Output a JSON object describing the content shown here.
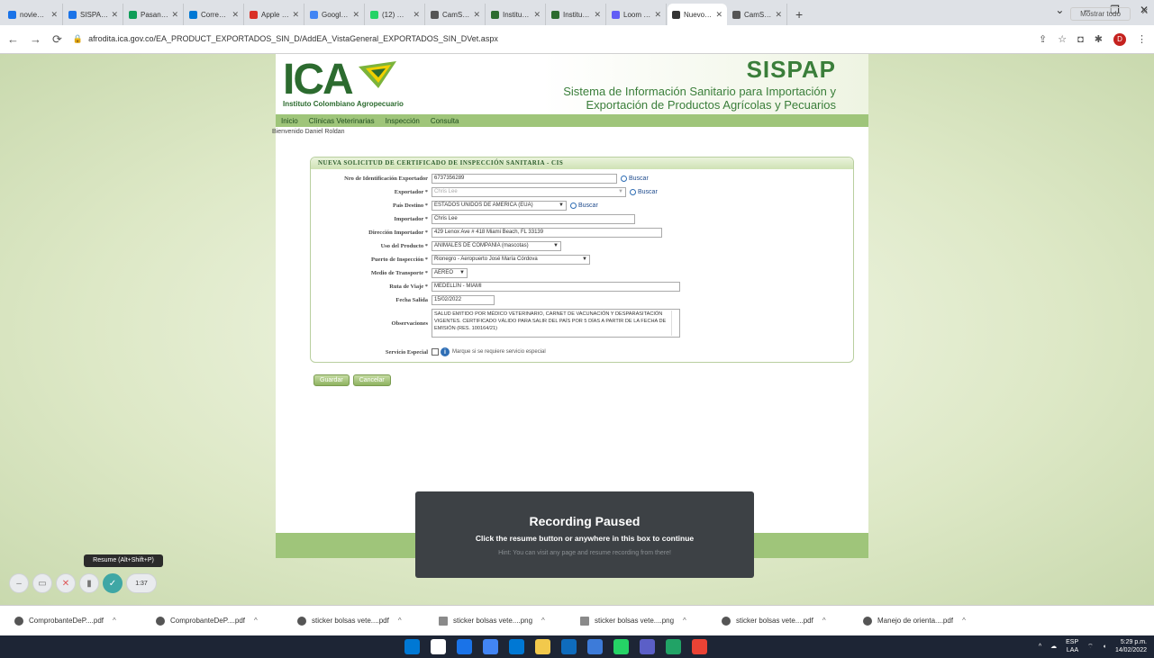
{
  "browser": {
    "tabs": [
      {
        "title": "noviembre",
        "color": "#1a73e8"
      },
      {
        "title": "SISPAP - Di",
        "color": "#1a73e8"
      },
      {
        "title": "Pasantes in",
        "color": "#0f9d58"
      },
      {
        "title": "Correo: Dia",
        "color": "#0078d4"
      },
      {
        "title": "Apple Mus",
        "color": "#d93025"
      },
      {
        "title": "Google Cal",
        "color": "#4285f4"
      },
      {
        "title": "(12) Whats",
        "color": "#25d366"
      },
      {
        "title": "CamScann",
        "color": "#555555"
      },
      {
        "title": "Instituto Co",
        "color": "#2c6b2f"
      },
      {
        "title": "Instituto Co",
        "color": "#2c6b2f"
      },
      {
        "title": "Loom | Fre",
        "color": "#625df5"
      },
      {
        "title": "Nuevo CIS",
        "color": "#333333",
        "active": true
      },
      {
        "title": "CamScann",
        "color": "#555555"
      }
    ],
    "url": "afrodita.ica.gov.co/EA_PRODUCT_EXPORTADOS_SIN_D/AddEA_VistaGeneral_EXPORTADOS_SIN_DVet.aspx"
  },
  "header": {
    "logo": "ICA",
    "logo_subtitle": "Instituto Colombiano Agropecuario",
    "app_name": "SISPAP",
    "app_description": "Sistema de Información Sanitario para Importación y Exportación de Productos Agrícolas y Pecuarios"
  },
  "menu": {
    "items": [
      "Inicio",
      "Clínicas Veterinarias",
      "Inspección",
      "Consulta"
    ],
    "welcome": "Bienvenido Daniel Roldan"
  },
  "form": {
    "title": "NUEVA SOLICITUD DE CERTIFICADO DE INSPECCIÓN SANITARIA - CIS",
    "buscar_label": "Buscar",
    "fields": {
      "nro_id": {
        "label": "Nro de Identificación Exportador",
        "value": "6737356289"
      },
      "exportador": {
        "label": "Exportador *",
        "value": "Chris Lee"
      },
      "pais_destino": {
        "label": "País Destino *",
        "value": "ESTADOS UNIDOS DE AMERICA (EUA)"
      },
      "importador": {
        "label": "Importador *",
        "value": "Chris Lee"
      },
      "direccion": {
        "label": "Dirección Importador *",
        "value": "429 Lenox Ave # 418 Miami Beach, FL 33139"
      },
      "uso": {
        "label": "Uso del Producto *",
        "value": "ANIMALES DE COMPAÑÍA (mascotas)"
      },
      "puerto": {
        "label": "Puerto de Inspección *",
        "value": "Rionegro - Aeropuerto José María Córdova"
      },
      "medio": {
        "label": "Medio de Transporte *",
        "value": "AÉREO"
      },
      "ruta": {
        "label": "Ruta de Viaje *",
        "value": "MEDELLÍN - MIAMI"
      },
      "fecha": {
        "label": "Fecha Salida",
        "value": "15/02/2022"
      },
      "observaciones": {
        "label": "Observaciones",
        "value": "SALUD EMITIDO POR MÉDICO VETERINARIO, CARNET DE VACUNACIÓN Y DESPARASITACIÓN VIGENTES. CERTIFICADO VÁLIDO PARA SALIR DEL PAÍS POR 5 DÍAS A PARTIR DE LA FECHA DE EMISIÓN (RES. 100164/21)"
      },
      "servicio": {
        "label": "Servicio Especial",
        "hint": "Marque si se requiere servicio especial"
      }
    },
    "buttons": {
      "save": "Guardar",
      "cancel": "Cancelar"
    }
  },
  "recording": {
    "title": "Recording Paused",
    "message": "Click the resume button or anywhere in this box to continue",
    "hint": "Hint: You can visit any page and resume recording from there!"
  },
  "loom": {
    "tooltip": "Resume (Alt+Shift+P)",
    "timer": "1:37"
  },
  "downloads": {
    "items": [
      {
        "name": "ComprobanteDeP....pdf",
        "type": "pdf"
      },
      {
        "name": "ComprobanteDeP....pdf",
        "type": "pdf"
      },
      {
        "name": "sticker bolsas vete....pdf",
        "type": "pdf"
      },
      {
        "name": "sticker bolsas vete....png",
        "type": "img"
      },
      {
        "name": "sticker bolsas vete....png",
        "type": "img"
      },
      {
        "name": "sticker bolsas vete....pdf",
        "type": "pdf"
      },
      {
        "name": "Manejo de orienta....pdf",
        "type": "pdf"
      }
    ],
    "show_all": "Mostrar todo"
  },
  "taskbar": {
    "lang": "ESP",
    "lang_sub": "LAA",
    "time": "5:29 p.m.",
    "date": "14/02/2022",
    "icon_colors": [
      "#0078d4",
      "#ffffff",
      "#1a73e8",
      "#4285f4",
      "#0078d4",
      "#f2c94c",
      "#0f6cbd",
      "#3d7bd9",
      "#25d366",
      "#5b5fc7",
      "#21a366",
      "#ea4335"
    ]
  }
}
